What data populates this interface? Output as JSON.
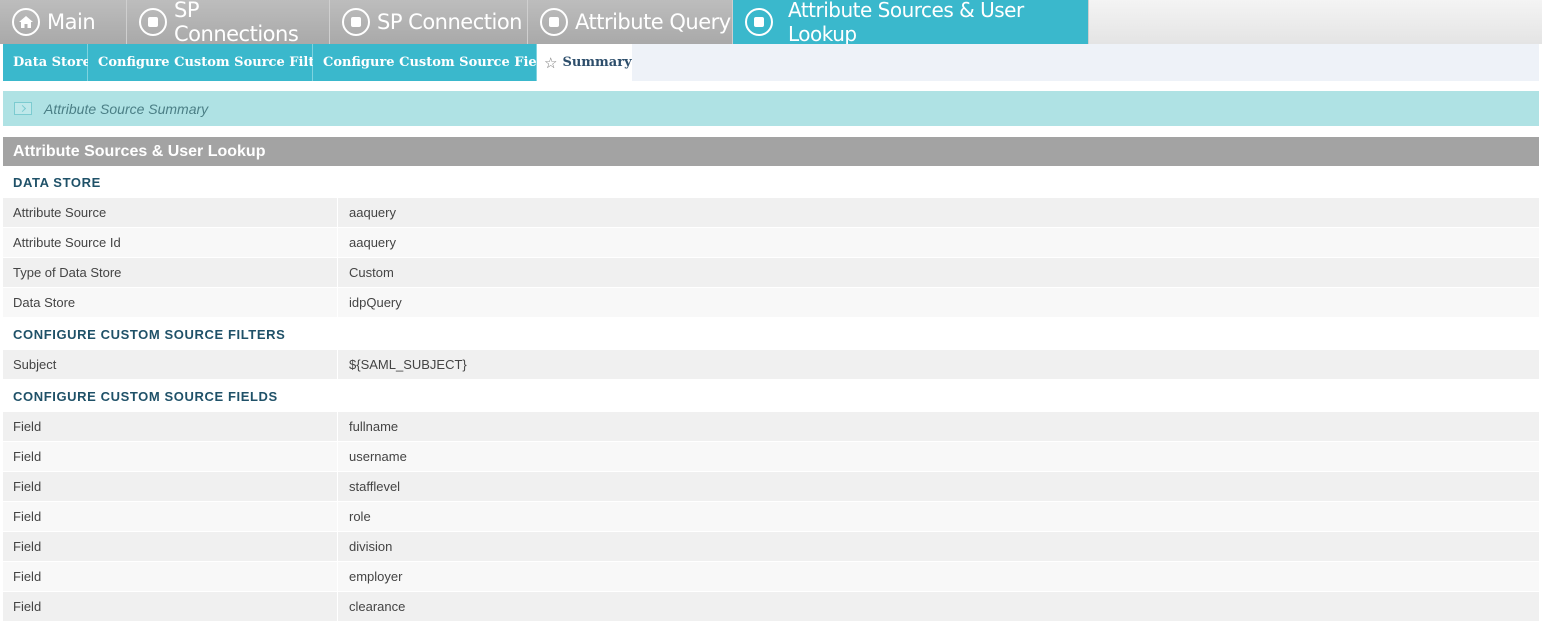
{
  "top_tabs": [
    {
      "label": "Main",
      "icon": "home-icon"
    },
    {
      "label": "SP Connections",
      "icon": "square-dot-icon"
    },
    {
      "label": "SP Connection",
      "icon": "square-dot-icon"
    },
    {
      "label": "Attribute Query",
      "icon": "square-dot-icon"
    },
    {
      "label": "Attribute Sources & User Lookup",
      "icon": "square-dot-icon",
      "active": true
    }
  ],
  "sub_tabs": [
    {
      "label": "Data Store"
    },
    {
      "label": "Configure Custom Source Filters"
    },
    {
      "label": "Configure Custom Source Fields"
    },
    {
      "label": "Summary",
      "icon": "star-icon",
      "active": true
    }
  ],
  "page_heading": "Attribute Source Summary",
  "section_title": "Attribute Sources & User Lookup",
  "groups": [
    {
      "title": "DATA STORE",
      "rows": [
        {
          "label": "Attribute Source",
          "value": "aaquery"
        },
        {
          "label": "Attribute Source Id",
          "value": "aaquery"
        },
        {
          "label": "Type of Data Store",
          "value": "Custom"
        },
        {
          "label": "Data Store",
          "value": "idpQuery"
        }
      ]
    },
    {
      "title": "CONFIGURE CUSTOM SOURCE FILTERS",
      "rows": [
        {
          "label": "Subject",
          "value": "${SAML_SUBJECT}"
        }
      ]
    },
    {
      "title": "CONFIGURE CUSTOM SOURCE FIELDS",
      "rows": [
        {
          "label": "Field",
          "value": "fullname"
        },
        {
          "label": "Field",
          "value": "username"
        },
        {
          "label": "Field",
          "value": "stafflevel"
        },
        {
          "label": "Field",
          "value": "role"
        },
        {
          "label": "Field",
          "value": "division"
        },
        {
          "label": "Field",
          "value": "employer"
        },
        {
          "label": "Field",
          "value": "clearance"
        }
      ]
    }
  ],
  "colors": {
    "accent": "#3ab8cc",
    "tab_inactive": "#b2b2b2",
    "heading_bar": "#afe2e4",
    "section_bar": "#a3a3a3",
    "group_title": "#1f5168"
  }
}
